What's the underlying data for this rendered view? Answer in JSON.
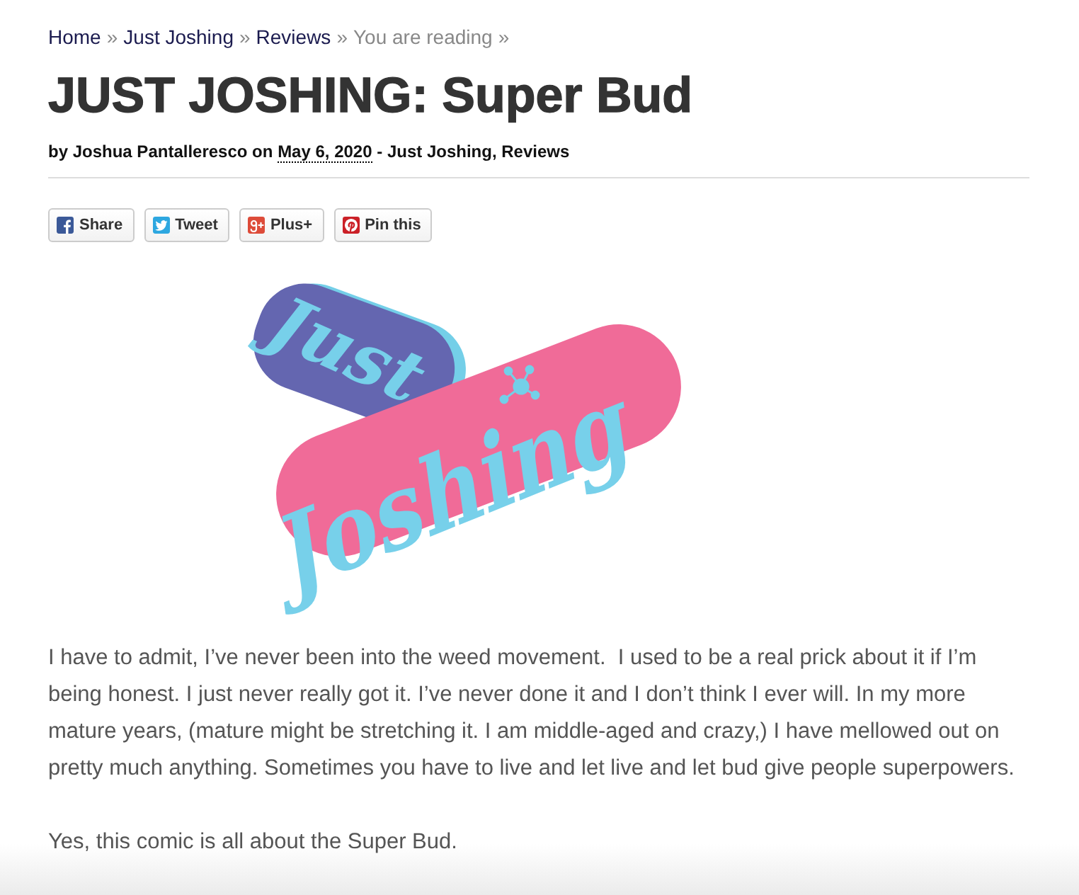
{
  "breadcrumb": [
    {
      "label": "Home",
      "kind": "link",
      "separator": "»"
    },
    {
      "label": "Just Joshing",
      "kind": "link",
      "separator": "»"
    },
    {
      "label": "Reviews",
      "kind": "link",
      "separator": "»"
    },
    {
      "label": "You are reading",
      "kind": "current",
      "separator": "»"
    }
  ],
  "post": {
    "title": "JUST JOSHING: Super Bud",
    "byline": {
      "before": "by Joshua Pantalleresco on",
      "date": "May 6, 2020",
      "after": "- Just Joshing, Reviews"
    }
  },
  "share_buttons": [
    {
      "kind": "facebook",
      "label": "Share"
    },
    {
      "kind": "twitter",
      "label": "Tweet"
    },
    {
      "kind": "googleplus",
      "label": "Plus+"
    },
    {
      "kind": "pinterest",
      "label": "Pin this"
    }
  ],
  "logo": {
    "top_word": "Just",
    "bottom_word": "Joshing"
  },
  "paragraphs": [
    "I have to admit, I’ve never been into the weed movement.  I used to be a real prick about it if I’m being honest. I just never really got it. I’ve never done it and I don’t think I ever will. In my more mature years, (mature might be stretching it. I am middle-aged and crazy,) I have mellowed out on pretty much anything. Sometimes you have to live and let live and let bud give people superpowers.",
    "Yes, this comic is all about the Super Bud."
  ]
}
